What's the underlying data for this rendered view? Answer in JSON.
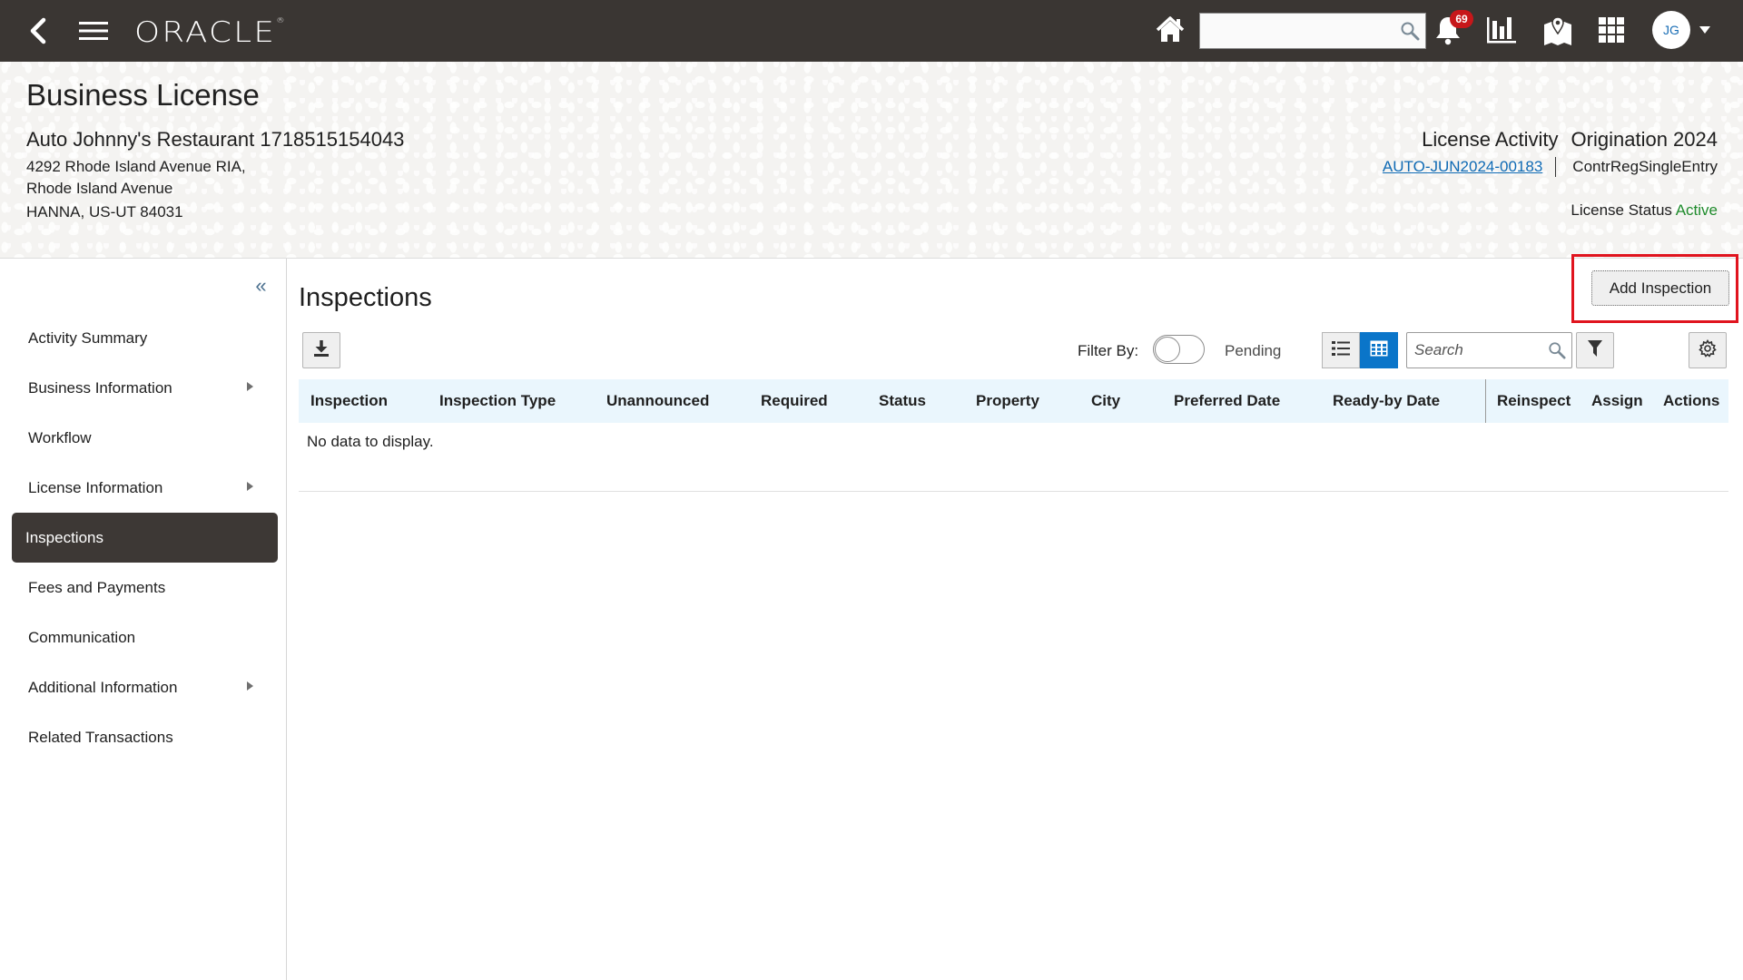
{
  "topbar": {
    "logo": "ORACLE",
    "logo_mark": "®",
    "search": {
      "value": "",
      "placeholder": ""
    },
    "notification_count": "69",
    "avatar_initials": "JG",
    "icons": [
      "back-icon",
      "hamburger-menu-icon",
      "home-icon",
      "search-icon",
      "bell-icon",
      "bar-chart-icon",
      "map-icon",
      "apps-grid-icon",
      "caret-down-icon"
    ]
  },
  "banner": {
    "title": "Business License",
    "business_name": "Auto Johnny's Restaurant 1718515154043",
    "address_line1": "4292 Rhode Island Avenue RIA,",
    "address_line2": "Rhode Island Avenue",
    "address_line3": "HANNA, US-UT 84031",
    "activity_label": "License Activity",
    "activity_type": "Origination 2024",
    "application_id": "AUTO-JUN2024-00183",
    "application_type": "ContrRegSingleEntry",
    "status_label": "License Status",
    "status_value": "Active",
    "status_color": "#1f8b2c"
  },
  "sidebar": {
    "collapse_icon": "«",
    "items": [
      {
        "label": "Activity Summary",
        "has_submenu": false,
        "selected": false
      },
      {
        "label": "Business Information",
        "has_submenu": true,
        "selected": false
      },
      {
        "label": "Workflow",
        "has_submenu": false,
        "selected": false
      },
      {
        "label": "License Information",
        "has_submenu": true,
        "selected": false
      },
      {
        "label": "Inspections",
        "has_submenu": false,
        "selected": true
      },
      {
        "label": "Fees and Payments",
        "has_submenu": false,
        "selected": false
      },
      {
        "label": "Communication",
        "has_submenu": false,
        "selected": false
      },
      {
        "label": "Additional Information",
        "has_submenu": true,
        "selected": false
      },
      {
        "label": "Related Transactions",
        "has_submenu": false,
        "selected": false
      }
    ]
  },
  "main": {
    "title": "Inspections",
    "add_button": "Add Inspection",
    "filter_by_label": "Filter By:",
    "filter_toggle_on": false,
    "pending_label": "Pending",
    "table_search_placeholder": "Search",
    "view_mode": "table",
    "accent_color": "#0a75c9",
    "highlight_color": "#e0141e",
    "table": {
      "columns": [
        "Inspection",
        "Inspection Type",
        "Unannounced",
        "Required",
        "Status",
        "Property",
        "City",
        "Preferred Date",
        "Ready-by Date",
        "Reinspect",
        "Assign",
        "Actions"
      ],
      "rows": [],
      "empty_message": "No data to display."
    }
  }
}
